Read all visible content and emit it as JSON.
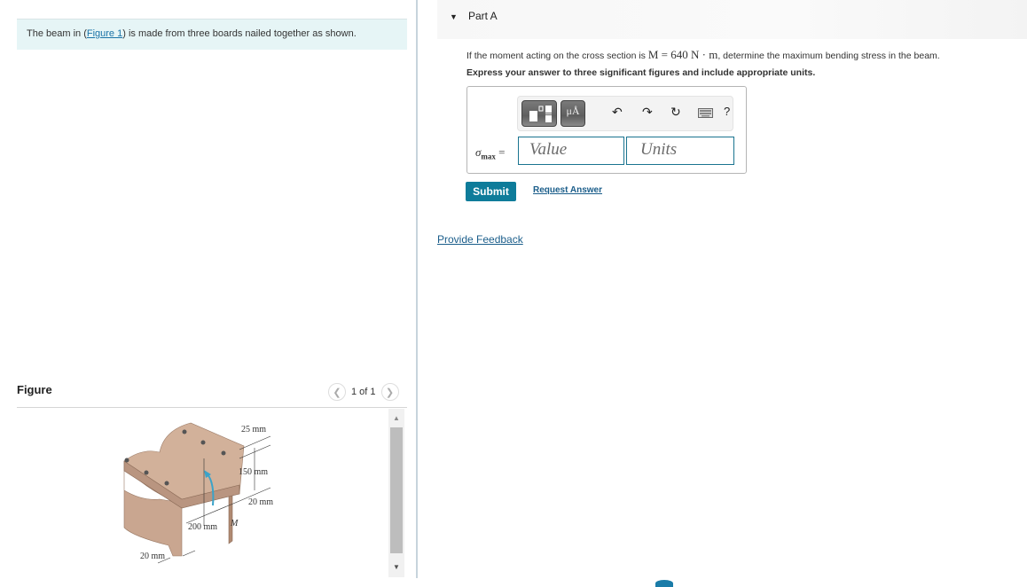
{
  "intro": {
    "prefix": "The beam in (",
    "link": "Figure 1",
    "suffix": ") is made from three boards nailed together as shown."
  },
  "figure": {
    "title": "Figure",
    "pager": {
      "current_label": "1 of 1",
      "prev_icon": "chevron-left-icon",
      "next_icon": "chevron-right-icon"
    },
    "labels": {
      "top_thickness": "25 mm",
      "web_height": "150 mm",
      "side_thickness_right": "20 mm",
      "width": "200 mm",
      "moment": "M",
      "side_thickness_left": "20 mm"
    }
  },
  "part": {
    "toggle_icon": "caret-down-icon",
    "label": "Part A",
    "question_prefix": "If the moment acting on the cross section is ",
    "question_math": "M = 640 N · m",
    "question_suffix": ", determine the maximum bending stress in the beam.",
    "instruction": "Express your answer to three significant figures and include appropriate units.",
    "toolbar": {
      "template_icon": "templates-icon",
      "units_label": "μÅ",
      "undo_icon": "undo-icon",
      "redo_icon": "redo-icon",
      "reset_icon": "reset-icon",
      "keyboard_icon": "keyboard-icon",
      "help_label": "?"
    },
    "answer": {
      "variable": "σ",
      "subscript": "max",
      "equals": "=",
      "value_placeholder": "Value",
      "units_placeholder": "Units",
      "value": "",
      "units": ""
    },
    "submit_label": "Submit",
    "request_answer_label": "Request Answer"
  },
  "feedback_label": "Provide Feedback",
  "colors": {
    "accent": "#0e7c9a",
    "link": "#1a5d8a",
    "intro_bg": "#e6f5f6"
  }
}
